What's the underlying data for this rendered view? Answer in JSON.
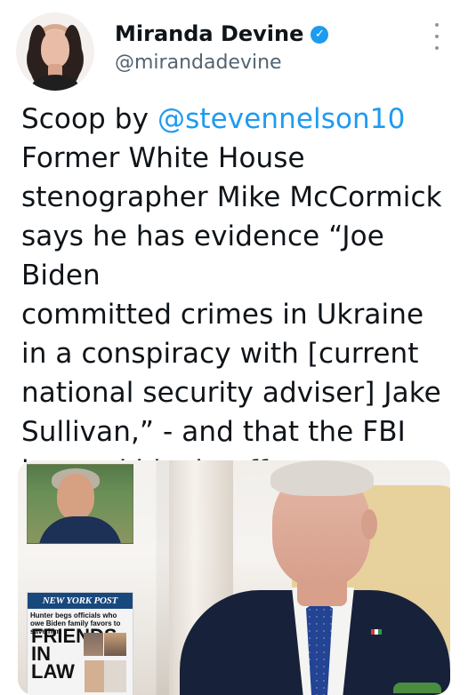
{
  "user": {
    "display_name": "Miranda Devine",
    "handle": "@mirandadevine"
  },
  "tweet": {
    "prefix": "Scoop by ",
    "mention": "@stevennelson10",
    "line_2": "Former White House",
    "line_3": "stenographer Mike McCormick",
    "line_4": "says he has evidence “Joe Biden",
    "line_5": "committed crimes in Ukraine",
    "line_6": "in a conspiracy with [current",
    "line_7": "national security adviser] Jake",
    "line_8": "Sullivan,” - and that the FBI",
    "line_9": "ignored his tip-off."
  },
  "newspaper": {
    "masthead": "NEW YORK POST",
    "subhead": "Hunter begs officials who owe Biden family favors to save him",
    "headline_line_1": "FRIENDS",
    "headline_line_2": "IN",
    "headline_line_3": "LAW"
  },
  "icons": {
    "verified": "verified-badge-icon",
    "more": "more-options-icon"
  },
  "colors": {
    "accent": "#1d9bf0",
    "text": "#0f1419",
    "secondary_text": "#536471"
  }
}
